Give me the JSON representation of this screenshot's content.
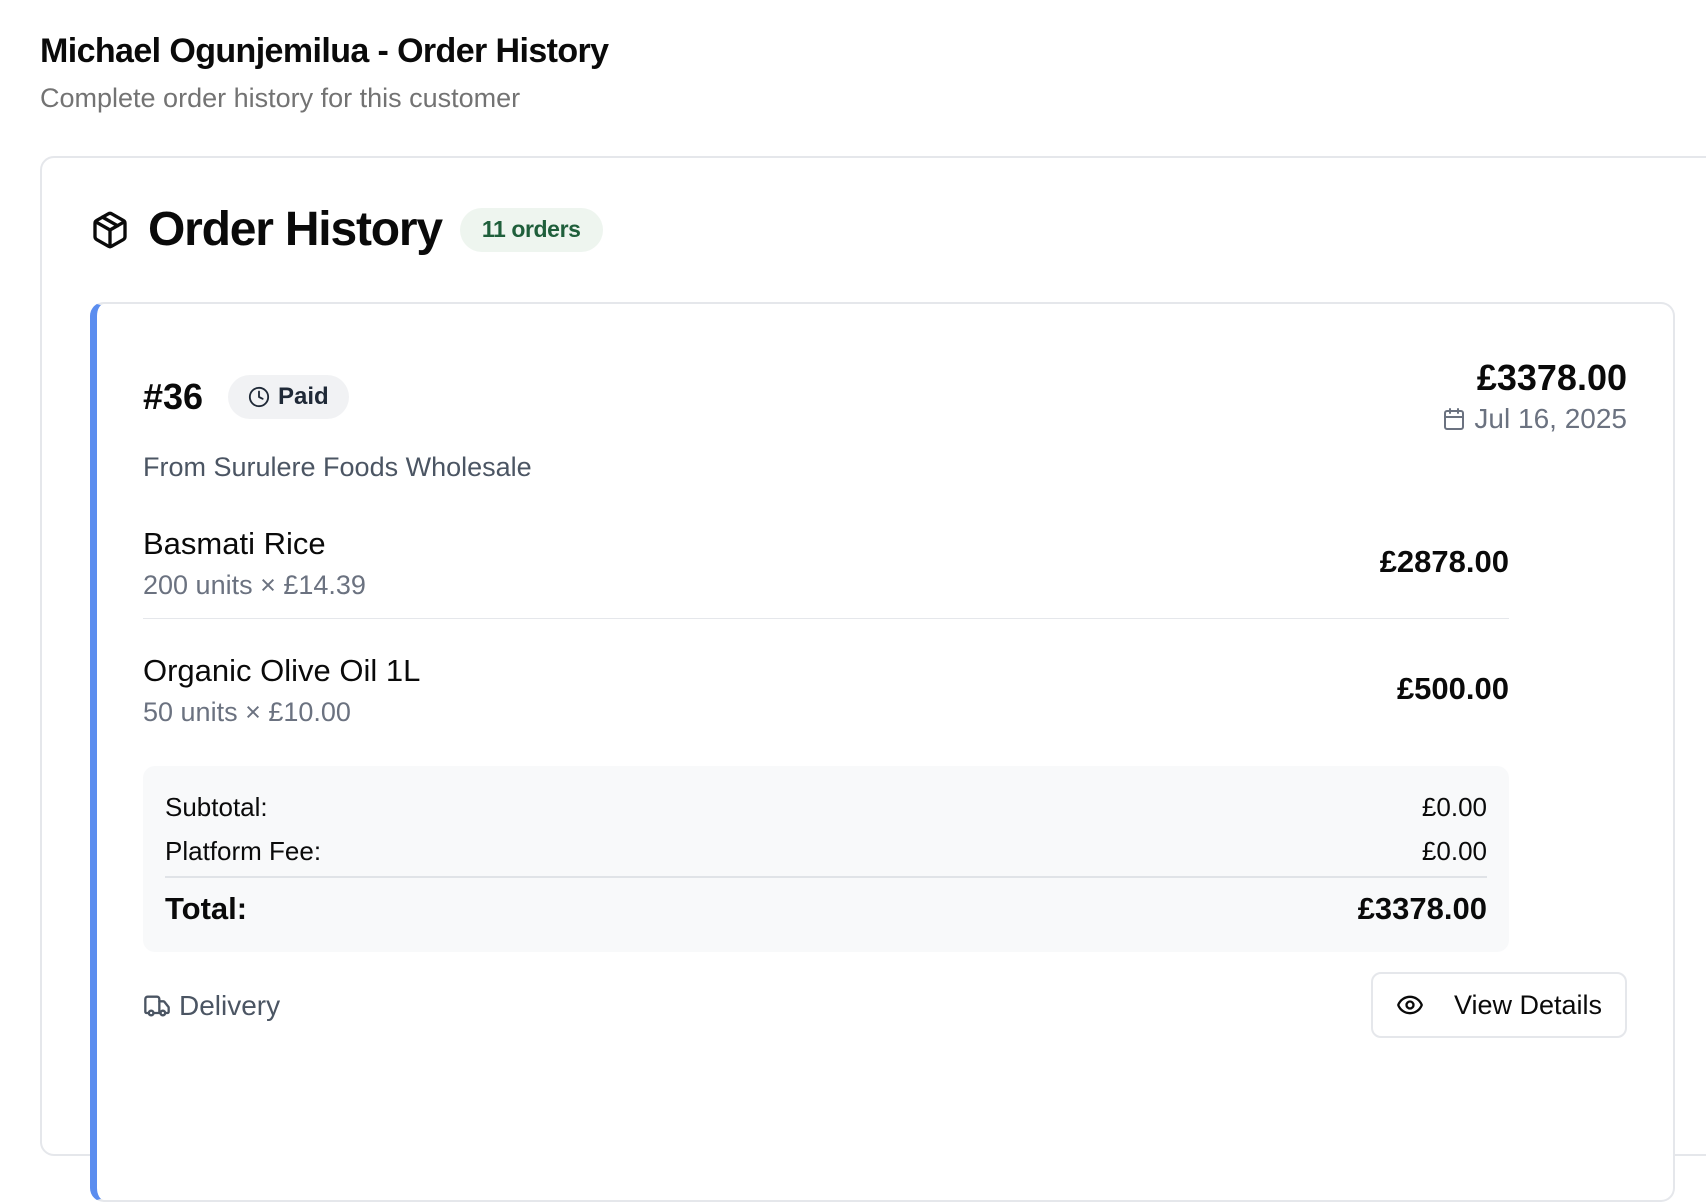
{
  "page": {
    "title": "Michael Ogunjemilua - Order History",
    "subtitle": "Complete order history for this customer"
  },
  "section": {
    "title": "Order History",
    "icon": "package-icon",
    "count_badge": "11 orders"
  },
  "order": {
    "id": "#36",
    "status": "Paid",
    "status_icon": "clock-icon",
    "total": "£3378.00",
    "date": "Jul 16, 2025",
    "date_icon": "calendar-icon",
    "vendor": "From Surulere Foods Wholesale",
    "accent_color": "#5b8def",
    "items": [
      {
        "name": "Basmati Rice",
        "qty": "200 units × £14.39",
        "price": "£2878.00"
      },
      {
        "name": "Organic Olive Oil 1L",
        "qty": "50 units × £10.00",
        "price": "£500.00"
      }
    ],
    "summary": {
      "subtotal_label": "Subtotal:",
      "subtotal_value": "£0.00",
      "fee_label": "Platform Fee:",
      "fee_value": "£0.00",
      "total_label": "Total:",
      "total_value": "£3378.00"
    },
    "fulfillment": "Delivery",
    "fulfillment_icon": "truck-icon",
    "view_button": "View Details",
    "view_icon": "eye-icon"
  }
}
